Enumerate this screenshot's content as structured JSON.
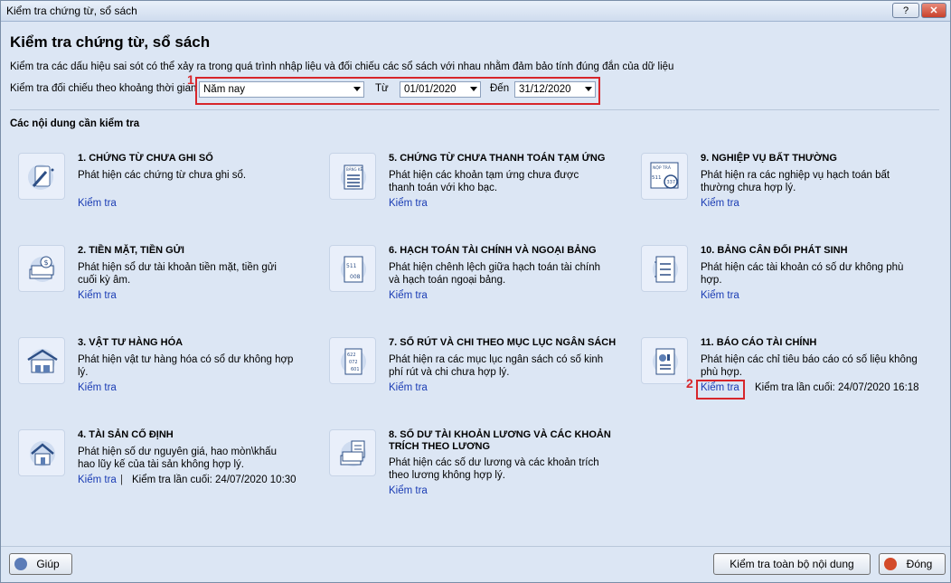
{
  "window": {
    "title": "Kiểm tra chứng từ, sổ sách",
    "help_label": "?",
    "close_label": "✕"
  },
  "header": {
    "title": "Kiểm tra chứng từ, sổ sách",
    "description": "Kiểm tra các dấu hiệu sai sót có thể xảy ra trong quá trình nhập liệu và đối chiếu các sổ sách với nhau nhằm đảm bảo tính đúng đắn của dữ liệu",
    "period_label": "Kiểm tra đối chiếu theo khoảng thời gian",
    "period_value": "Năm nay",
    "from_label": "Từ",
    "from_value": "01/01/2020",
    "to_label": "Đến",
    "to_value": "31/12/2020",
    "marker1": "1",
    "marker2": "2"
  },
  "section_title": "Các nội dung cần kiểm tra",
  "items": [
    {
      "title": "1. CHỨNG TỪ CHƯA GHI SỔ",
      "desc": "Phát hiện các chứng từ chưa ghi sổ.",
      "link": "Kiểm tra",
      "icon": "pen-document-icon"
    },
    {
      "title": "2. TIỀN MẶT, TIỀN GỬI",
      "desc": "Phát hiện sổ dư tài khoản tiền mặt, tiền gửi cuối kỳ âm.",
      "link": "Kiểm tra",
      "icon": "cash-icon"
    },
    {
      "title": "3. VẬT TƯ HÀNG HÓA",
      "desc": "Phát hiện vật tư hàng hóa có sổ dư không hợp lý.",
      "link": "Kiểm tra",
      "icon": "warehouse-icon"
    },
    {
      "title": "4. TÀI SẢN CỐ ĐỊNH",
      "desc": "Phát hiện số dư nguyên giá, hao mòn\\khấu hao lũy kế của tài sản không hợp lý.",
      "link": "Kiểm tra",
      "sep": "|",
      "last_check": "Kiểm tra lần cuối: 24/07/2020 10:30",
      "icon": "house-icon"
    },
    {
      "title": "5. CHỨNG TỪ CHƯA THANH TOÁN TẠM ỨNG",
      "desc": "Phát hiện các khoản tạm ứng chưa được thanh toán với kho bạc.",
      "link": "Kiểm tra",
      "icon": "checklist-icon",
      "icon_text": "BẢNG KÊ"
    },
    {
      "title": "6. HẠCH TOÁN TÀI CHÍNH VÀ NGOẠI BẢNG",
      "desc": "Phát hiện chênh lệch giữa hạch toán tài chính và hạch toán ngoại bảng.",
      "link": "Kiểm tra",
      "icon": "ledger-icon",
      "icon_text": [
        "511",
        "008"
      ]
    },
    {
      "title": "7. SỐ RÚT VÀ CHI THEO MỤC LỤC NGÂN SÁCH",
      "desc": "Phát hiện ra các mục lục ngân sách có số kinh phí rút và chi chưa hợp lý.",
      "link": "Kiểm tra",
      "icon": "budget-list-icon",
      "icon_text": [
        "622",
        "072",
        "601"
      ]
    },
    {
      "title": "8. SỐ DƯ TÀI KHOẢN LƯƠNG VÀ CÁC KHOẢN TRÍCH THEO LƯƠNG",
      "desc": "Phát hiện các số dư lương và các khoản trích theo lương không hợp lý.",
      "link": "Kiểm tra",
      "icon": "salary-icon"
    },
    {
      "title": "9. NGHIỆP VỤ BẤT THƯỜNG",
      "desc": "Phát hiện ra các nghiệp vụ hạch toán bất thường chưa hợp lý.",
      "link": "Kiểm tra",
      "icon": "search-document-icon",
      "icon_text": [
        "NỘP TRẢ",
        "511",
        "337"
      ]
    },
    {
      "title": "10. BẢNG CÂN ĐỐI PHÁT SINH",
      "desc": "Phát hiện các tài khoản có số dư không phù hợp.",
      "link": "Kiểm tra",
      "icon": "balance-sheet-icon"
    },
    {
      "title": "11. BÁO CÁO TÀI CHÍNH",
      "desc": "Phát hiện các chỉ tiêu báo cáo có số liệu không phù hợp.",
      "link": "Kiểm tra",
      "last_check": "Kiểm tra lần cuối: 24/07/2020 16:18",
      "icon": "financial-report-icon"
    }
  ],
  "footer": {
    "help_label": "Giúp",
    "check_all_label": "Kiểm tra toàn bộ nội dung",
    "close_label": "Đóng"
  },
  "colors": {
    "accent": "#1a3cb4",
    "highlight": "#d7262b",
    "background": "#dce6f4"
  }
}
